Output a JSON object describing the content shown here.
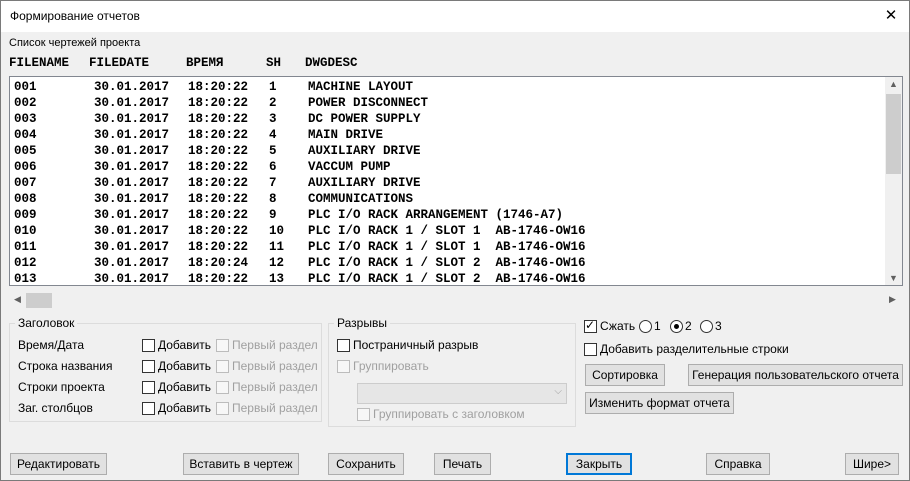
{
  "window": {
    "title": "Формирование отчетов",
    "close_glyph": "✕"
  },
  "list": {
    "caption": "Список чертежей проекта",
    "headers": {
      "filename": "FILENAME",
      "filedate": "FILEDATE",
      "time": "ВРЕМЯ",
      "sh": "SH",
      "dwgdesc": "DWGDESC"
    },
    "rows": [
      {
        "f": "001",
        "d": "30.01.2017",
        "t": "18:20:22",
        "sh": "1",
        "desc": "MACHINE LAYOUT"
      },
      {
        "f": "002",
        "d": "30.01.2017",
        "t": "18:20:22",
        "sh": "2",
        "desc": "POWER DISCONNECT"
      },
      {
        "f": "003",
        "d": "30.01.2017",
        "t": "18:20:22",
        "sh": "3",
        "desc": "DC POWER SUPPLY"
      },
      {
        "f": "004",
        "d": "30.01.2017",
        "t": "18:20:22",
        "sh": "4",
        "desc": "MAIN DRIVE"
      },
      {
        "f": "005",
        "d": "30.01.2017",
        "t": "18:20:22",
        "sh": "5",
        "desc": "AUXILIARY DRIVE"
      },
      {
        "f": "006",
        "d": "30.01.2017",
        "t": "18:20:22",
        "sh": "6",
        "desc": "VACCUM PUMP"
      },
      {
        "f": "007",
        "d": "30.01.2017",
        "t": "18:20:22",
        "sh": "7",
        "desc": "AUXILIARY DRIVE"
      },
      {
        "f": "008",
        "d": "30.01.2017",
        "t": "18:20:22",
        "sh": "8",
        "desc": "COMMUNICATIONS"
      },
      {
        "f": "009",
        "d": "30.01.2017",
        "t": "18:20:22",
        "sh": "9",
        "desc": "PLC I/O RACK ARRANGEMENT (1746-A7)"
      },
      {
        "f": "010",
        "d": "30.01.2017",
        "t": "18:20:22",
        "sh": "10",
        "desc": "PLC I/O RACK 1 / SLOT 1  AB-1746-OW16"
      },
      {
        "f": "011",
        "d": "30.01.2017",
        "t": "18:20:22",
        "sh": "11",
        "desc": "PLC I/O RACK 1 / SLOT 1  AB-1746-OW16"
      },
      {
        "f": "012",
        "d": "30.01.2017",
        "t": "18:20:24",
        "sh": "12",
        "desc": "PLC I/O RACK 1 / SLOT 2  AB-1746-OW16"
      },
      {
        "f": "013",
        "d": "30.01.2017",
        "t": "18:20:22",
        "sh": "13",
        "desc": "PLC I/O RACK 1 / SLOT 2  AB-1746-OW16"
      }
    ]
  },
  "header_group": {
    "title": "Заголовок",
    "rows": [
      {
        "label": "Время/Дата",
        "add": "Добавить",
        "first": "Первый раздел"
      },
      {
        "label": "Строка названия",
        "add": "Добавить",
        "first": "Первый раздел"
      },
      {
        "label": "Строки проекта",
        "add": "Добавить",
        "first": "Первый раздел"
      },
      {
        "label": "Заг. столбцов",
        "add": "Добавить",
        "first": "Первый раздел"
      }
    ]
  },
  "breaks_group": {
    "title": "Разрывы",
    "page_break": "Постраничный разрыв",
    "group": "Группировать",
    "group_with_header": "Группировать с заголовком"
  },
  "compress": {
    "label": "Сжать",
    "checked": true,
    "options": [
      "1",
      "2",
      "3"
    ],
    "selected": "2"
  },
  "separator_rows": "Добавить разделительные строки",
  "buttons": {
    "sort": "Сортировка",
    "user_report": "Генерация пользовательского отчета",
    "change_format": "Изменить формат отчета",
    "edit": "Редактировать",
    "insert": "Вставить в чертеж",
    "save": "Сохранить",
    "print": "Печать",
    "close": "Закрыть",
    "help": "Справка",
    "wider": "Шире>"
  }
}
